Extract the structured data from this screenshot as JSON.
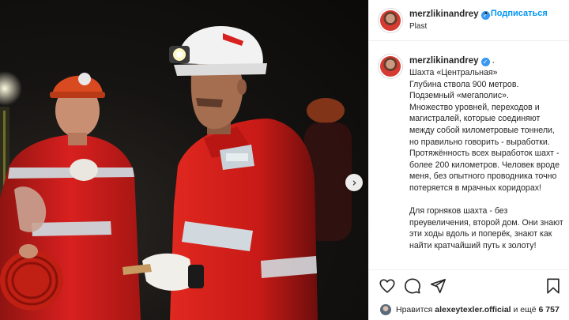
{
  "header": {
    "username": "merzlikinandrey",
    "follow_separator": "•",
    "follow_label": "Подписаться",
    "location": "Plast"
  },
  "caption": {
    "username": "merzlikinandrey",
    "trailing": ".",
    "text": "Шахта «Центральная»\nГлубина ствола 900 метров.\nПодземный «мегаполис».\nМножество уровней, переходов и магистралей, которые соединяют между собой километровые тоннели, но правильно говорить - выработки. Протяжённость всех выработок шахт - более 200 километров. Человек вроде меня, без опытного проводника точно потеряется в мрачных коридорах!\n\nДля горняков шахта - без преувеличения, второй дом. Они знают эти ходы вдоль и поперёк, знают как найти кратчайший путь к золоту!"
  },
  "likes": {
    "prefix": "Нравится",
    "user": "alexeytexler.official",
    "middle": "и ещё",
    "count": "6 757"
  },
  "icons": {
    "verified": "verified-badge-icon",
    "next": "chevron-right-icon",
    "like": "heart-icon",
    "comment": "comment-bubble-icon",
    "share": "paper-plane-icon",
    "save": "bookmark-icon"
  },
  "colors": {
    "accent": "#0095f6",
    "verified": "#3897f0",
    "suit_red": "#d8201f",
    "helmet_white": "#f2f2f2",
    "helmet_orange": "#d94a20"
  }
}
